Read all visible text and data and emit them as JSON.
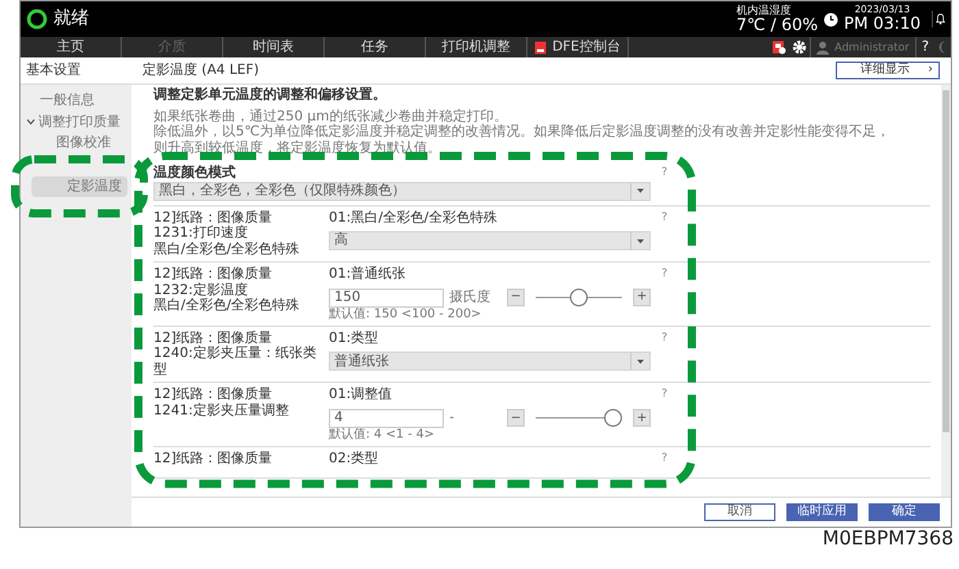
{
  "header": {
    "status": "就绪",
    "env_label": "机内温湿度",
    "env_value": "7℃ / 60%",
    "date": "2023/03/13",
    "time": "PM 03:10"
  },
  "nav": {
    "tabs": [
      {
        "label": "主页",
        "disabled": false,
        "kind": "text"
      },
      {
        "label": "介质",
        "disabled": true,
        "kind": "text"
      },
      {
        "label": "时间表",
        "disabled": false,
        "kind": "text"
      },
      {
        "label": "任务",
        "disabled": false,
        "kind": "text"
      },
      {
        "label": "打印机调整",
        "disabled": false,
        "kind": "text"
      },
      {
        "label": "DFE控制台",
        "disabled": false,
        "kind": "app"
      }
    ],
    "user": "Administrator",
    "help": "?"
  },
  "sidebar": {
    "title": "基本设置",
    "items": [
      {
        "label": "一般信息",
        "selected": false
      },
      {
        "label": "调整打印质量",
        "selected": false,
        "expanded": true,
        "children": [
          {
            "label": "图像校准",
            "selected": false
          },
          {
            "label": "定影温度",
            "selected": true
          }
        ]
      }
    ]
  },
  "page": {
    "title": "定影温度 (A4 LEF)",
    "detail_button": "详细显示",
    "detail_arrow": "›",
    "summary": "调整定影单元温度的调整和偏移设置。",
    "notes": [
      "如果纸张卷曲，通过250 μm的纸张减少卷曲并稳定打印。",
      "除低温外，以5℃为单位降低定影温度并稳定调整的改善情况。如果降低后定影温度调整的没有改善并定影性能变得不足，",
      "则升高到较低温度，将定影温度恢复为默认值。"
    ]
  },
  "mode": {
    "label": "温度颜色模式",
    "help": "?",
    "value": "黑白，全彩色，全彩色（仅限特殊颜色）"
  },
  "settings": [
    {
      "kind": "select",
      "labels": [
        "12]纸路：图像质量",
        "1231:打印速度",
        "黑白/全彩色/全彩色特殊"
      ],
      "item": "01:黑白/全彩色/全彩色特殊",
      "help": "?",
      "value": "高"
    },
    {
      "kind": "slider",
      "labels": [
        "12]纸路：图像质量",
        "1232:定影温度",
        "黑白/全彩色/全彩色特殊"
      ],
      "item": "01:普通纸张",
      "help": "?",
      "value": "150",
      "unit": "摄氏度",
      "minus": "−",
      "plus": "+",
      "level": 0.5,
      "default": "默认值: 150 <100 - 200>"
    },
    {
      "kind": "select",
      "labels": [
        "12]纸路：图像质量",
        "1240:定影夹压量：纸张类型"
      ],
      "item": "01:类型",
      "help": "?",
      "value": "普通纸张"
    },
    {
      "kind": "slider",
      "labels": [
        "12]纸路：图像质量",
        "1241:定影夹压量调整"
      ],
      "item": "01:调整值",
      "help": "?",
      "value": "4",
      "unit": "-",
      "minus": "−",
      "plus": "+",
      "level": 1,
      "default": "默认值: 4 <1 - 4>"
    },
    {
      "kind": "header",
      "labels": [
        "12]纸路：图像质量"
      ],
      "item": "02:类型",
      "help": "?"
    }
  ],
  "footer": {
    "buttons": [
      {
        "label": "取消",
        "kind": "outline"
      },
      {
        "label": "临时应用",
        "kind": "primary"
      },
      {
        "label": "确定",
        "kind": "primary"
      }
    ]
  },
  "caption": "M0EBPM7368"
}
